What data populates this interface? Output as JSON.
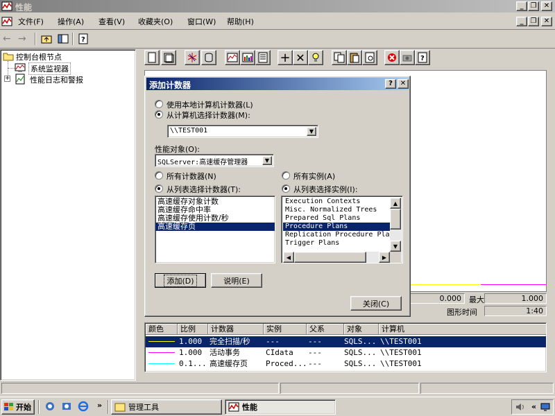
{
  "window": {
    "title": "性能"
  },
  "menu": [
    "文件(F)",
    "操作(A)",
    "查看(V)",
    "收藏夹(O)",
    "窗口(W)",
    "帮助(H)"
  ],
  "tree": {
    "root": "控制台根节点",
    "monitor": "系统监视器",
    "logs": "性能日志和警报"
  },
  "dialog": {
    "title": "添加计数器",
    "radio_local": "使用本地计算机计数器(L)",
    "radio_select": "从计算机选择计数器(M):",
    "computer": "\\\\TEST001",
    "perf_object_label": "性能对象(O):",
    "perf_object": "SQLServer:高速缓存管理器",
    "radio_all_counters": "所有计数器(N)",
    "radio_list_counters": "从列表选择计数器(T):",
    "radio_all_instances": "所有实例(A)",
    "radio_list_instances": "从列表选择实例(I):",
    "counters": [
      "高速缓存对象计数",
      "高速缓存命中率",
      "高速缓存使用计数/秒",
      "高速缓存页"
    ],
    "counters_selected": 3,
    "instances": [
      "Execution Contexts",
      "Misc. Normalized Trees",
      "Prepared Sql Plans",
      "Procedure Plans",
      "Replication Procedure Plans",
      "Trigger Plans"
    ],
    "instances_selected": 3,
    "add_button": "添加(D)",
    "explain_button": "说明(E)",
    "close_button": "关闭(C)"
  },
  "stats": {
    "value1": "0.000",
    "max_label": "最大",
    "max_value": "1.000",
    "duration_label": "图形时间",
    "duration_value": "1:40"
  },
  "counter_table": {
    "headers": [
      "颜色",
      "比例",
      "计数器",
      "实例",
      "父系",
      "对象",
      "计算机"
    ],
    "rows": [
      {
        "color": "#ffff00",
        "scale": "1.000",
        "counter": "完全扫描/秒",
        "instance": "---",
        "parent": "---",
        "object": "SQLS...",
        "computer": "\\\\TEST001",
        "selected": true
      },
      {
        "color": "#ff00ff",
        "scale": "1.000",
        "counter": "活动事务",
        "instance": "CIdata",
        "parent": "---",
        "object": "SQLS...",
        "computer": "\\\\TEST001",
        "selected": false
      },
      {
        "color": "#00ffff",
        "scale": "0.1...",
        "counter": "高速缓存页",
        "instance": "Proced...",
        "parent": "---",
        "object": "SQLS...",
        "computer": "\\\\TEST001",
        "selected": false
      }
    ]
  },
  "taskbar": {
    "start": "开始",
    "task1": "管理工具",
    "task2": "性能",
    "tray_chevron": "«"
  },
  "colors": {
    "title_active": "#0a246a",
    "title_inactive": "#808080",
    "desktop": "#d4d0c8",
    "graph_bg": "#ffffff"
  }
}
